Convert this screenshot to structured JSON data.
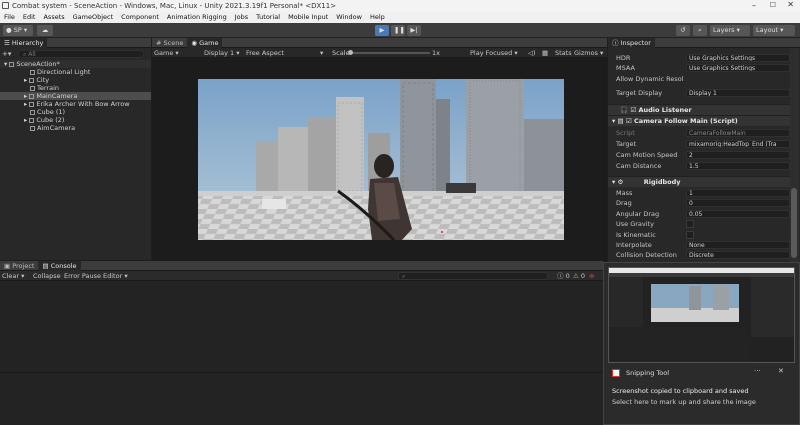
{
  "window": {
    "title": "Combat system - SceneAction - Windows, Mac, Linux - Unity 2021.3.19f1 Personal* <DX11>"
  },
  "menu": [
    "File",
    "Edit",
    "Assets",
    "GameObject",
    "Component",
    "Animation Rigging",
    "Jobs",
    "Tutorial",
    "Mobile Input",
    "Window",
    "Help"
  ],
  "toolbar": {
    "account": "SP",
    "layers": "Layers",
    "layout": "Layout"
  },
  "hierarchy": {
    "tab": "Hierarchy",
    "search_placeholder": "All",
    "root": "SceneAction*",
    "items": [
      "Directional Light",
      "City",
      "Terrain",
      "MainCamera",
      "Erika Archer With Bow Arrow",
      "Cube (1)",
      "Cube (2)",
      "AimCamera"
    ]
  },
  "game_view": {
    "tabs": [
      "Scene",
      "Game"
    ],
    "display_mode": "Game",
    "display": "Display 1",
    "aspect": "Free Aspect",
    "scale_label": "Scale",
    "scale_value": "1x",
    "play_focused": "Play Focused",
    "stats": "Stats",
    "gizmos": "Gizmos"
  },
  "console": {
    "tabs": [
      "Project",
      "Console"
    ],
    "buttons": [
      "Clear",
      "Collapse",
      "Error Pause",
      "Editor"
    ],
    "counts": [
      "0",
      "0",
      "0"
    ]
  },
  "inspector": {
    "tab": "Inspector",
    "camera_rows": [
      {
        "label": "HDR",
        "value": "Use Graphics Settings"
      },
      {
        "label": "MSAA",
        "value": "Use Graphics Settings"
      },
      {
        "label": "Allow Dynamic Resol",
        "value": ""
      },
      {
        "label": "Target Display",
        "value": "Display 1"
      }
    ],
    "audio_listener": "Audio Listener",
    "camera_follow": "Camera Follow Main (Script)",
    "script_rows": [
      {
        "label": "Script",
        "value": "CameraFollowMain"
      },
      {
        "label": "Target",
        "value": "mixamorig:HeadTop_End (Tra"
      },
      {
        "label": "Cam Motion Speed",
        "value": "2"
      },
      {
        "label": "Cam Distance",
        "value": "1.5"
      }
    ],
    "rigidbody": "Rigidbody",
    "rigidbody_rows": [
      {
        "label": "Mass",
        "value": "1"
      },
      {
        "label": "Drag",
        "value": "0"
      },
      {
        "label": "Angular Drag",
        "value": "0.05"
      },
      {
        "label": "Use Gravity",
        "value": ""
      },
      {
        "label": "Is Kinematic",
        "value": ""
      },
      {
        "label": "Interpolate",
        "value": "None"
      },
      {
        "label": "Collision Detection",
        "value": "Discrete"
      },
      {
        "label": "Constraints",
        "value": ""
      }
    ]
  },
  "toast": {
    "app": "Snipping Tool",
    "title": "Screenshot copied to clipboard and saved",
    "body": "Select here to mark up and share the image"
  }
}
